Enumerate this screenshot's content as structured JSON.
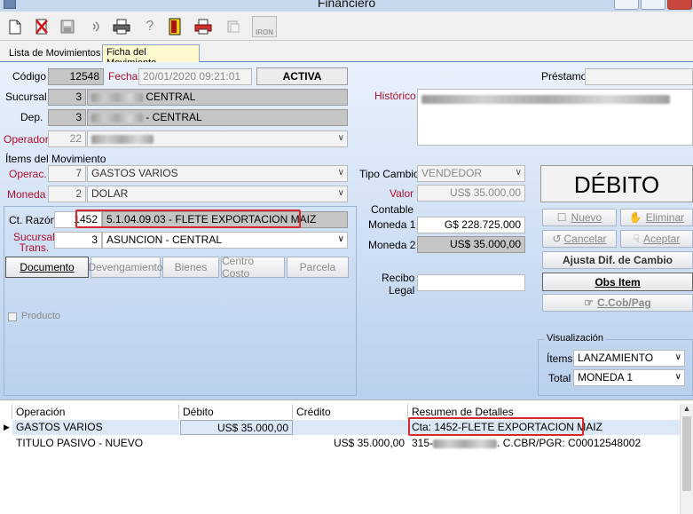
{
  "window": {
    "title": "Financiero"
  },
  "toolbar": {
    "items": [
      "new-doc-icon",
      "delete-icon",
      "save-icon",
      "audio-icon",
      "print-icon",
      "help-icon",
      "exit-icon",
      "print-red-icon",
      "copy-icon",
      "iron-icon"
    ],
    "iron_label": "IRON"
  },
  "tabs": [
    {
      "label": "Lista de Movimientos"
    },
    {
      "label": "Ficha del Movimiento"
    }
  ],
  "form": {
    "codigo_label": "Código",
    "codigo_value": "12548",
    "fecha_label": "Fecha",
    "fecha_value": "20/01/2020 09:21:01",
    "status": "ACTIVA",
    "prestamo_label": "Préstamo",
    "sucursal_label": "Sucursal",
    "sucursal_num": "3",
    "sucursal_name": "CENTRAL",
    "dep_label": "Dep.",
    "dep_num": "3",
    "dep_name": "- CENTRAL",
    "operador_label": "Operador",
    "operador_num": "22",
    "historico_label": "Histórico"
  },
  "items": {
    "section_label": "Ítems del Movimiento",
    "operac_label": "Operac.",
    "operac_num": "7",
    "operac_value": "GASTOS VARIOS",
    "moneda_label": "Moneda",
    "moneda_num": "2",
    "moneda_value": "DOLAR",
    "ctrazon_label": "Ct. Razón",
    "ctrazon_num": "1452",
    "ctrazon_value": "5.1.04.09.03 - FLETE EXPORTACION MAIZ",
    "sucursal_trans_label1": "Sucursal",
    "sucursal_trans_label2": "Trans.",
    "sucursal_trans_num": "3",
    "sucursal_trans_value": "ASUNCION - CENTRAL",
    "subtabs": [
      "Documento",
      "Devengamiento",
      "Bienes",
      "Centro Costo",
      "Parcela"
    ],
    "producto_label": "Producto"
  },
  "cambio": {
    "tipo_label": "Tipo Cambio",
    "tipo_value": "VENDEDOR",
    "valor_label": "Valor",
    "valor_value": "US$ 35.000,00",
    "contable_label": "Contable",
    "moneda1_label": "Moneda 1",
    "moneda1_value": "G$ 228.725.000",
    "moneda2_label": "Moneda 2",
    "moneda2_value": "US$ 35.000,00",
    "recibo_label1": "Recibo",
    "recibo_label2": "Legal"
  },
  "actions": {
    "debito_label": "DÉBITO",
    "nuevo": "Nuevo",
    "eliminar": "Eliminar",
    "cancelar": "Cancelar",
    "aceptar": "Aceptar",
    "ajusta": "Ajusta Dif. de Cambio",
    "obs_item": "Obs Item",
    "ccob": "C.Cob/Pag"
  },
  "visualizacion": {
    "title": "Visualización",
    "items_label": "Ítems",
    "items_value": "LANZAMIENTO",
    "total_label": "Total",
    "total_value": "MONEDA 1"
  },
  "grid": {
    "columns": [
      "Operación",
      "Débito",
      "Crédito",
      "Resumen de Detalles"
    ],
    "rows": [
      {
        "operacion": "GASTOS VARIOS",
        "debito": "US$ 35.000,00",
        "credito": "",
        "resumen": "Cta: 1452-FLETE EXPORTACION MAIZ"
      },
      {
        "operacion": "TITULO PASIVO - NUEVO",
        "debito": "",
        "credito": "US$ 35.000,00",
        "resumen_prefix": "315-",
        "resumen_suffix": ". C.CBR/PGR: C00012548002"
      }
    ]
  }
}
